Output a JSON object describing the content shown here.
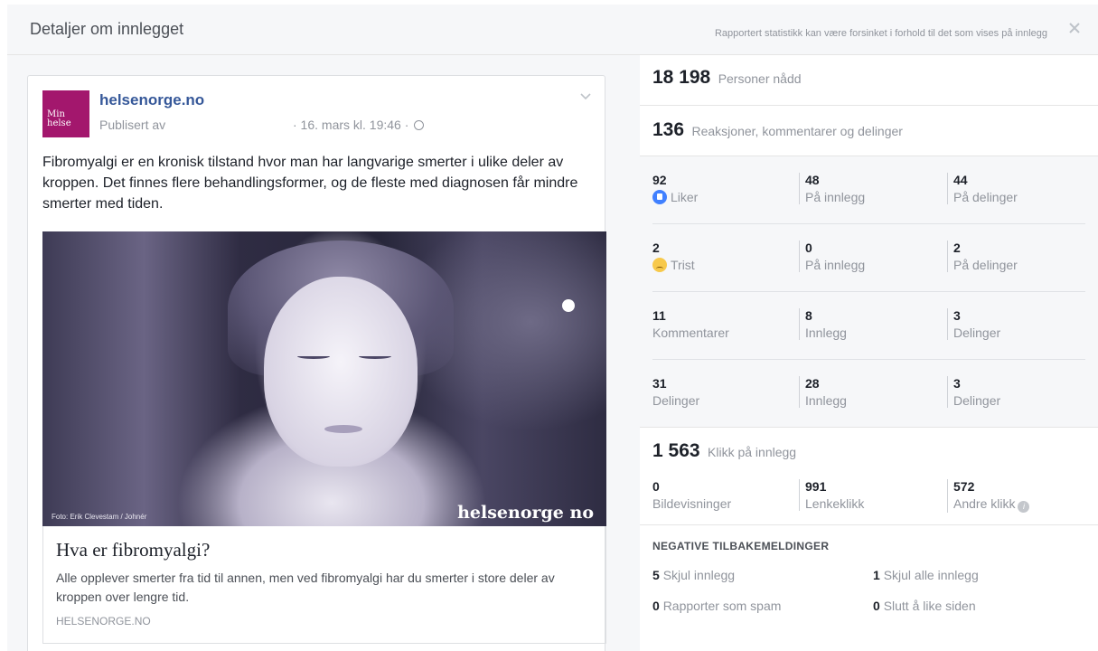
{
  "header": {
    "title": "Detaljer om innlegget",
    "note": "Rapportert statistikk kan være forsinket i forhold til det som vises på innlegg",
    "close_icon": "close-icon"
  },
  "post": {
    "avatar_text_line1": "Min",
    "avatar_text_line2": "helse",
    "page_name": "helsenorge.no",
    "published_by": "Publisert av",
    "date": "· 16. mars kl. 19:46 ·",
    "text": "Fibromyalgi er en kronisk tilstand hvor man har langvarige smerter i ulike deler av kroppen. Det finnes flere behandlingsformer, og de fleste med diagnosen får mindre smerter med tiden.",
    "image": {
      "credit": "Foto: Erik Clevestam / Johnér",
      "logo": "helsenorge no"
    },
    "link": {
      "title": "Hva er fibromyalgi?",
      "description": "Alle opplever smerter fra tid til annen, men ved fibromyalgi har du smerter i store deler av kroppen over lengre tid.",
      "domain": "HELSENORGE.NO"
    }
  },
  "stats": {
    "reach": {
      "value": "18 198",
      "label": "Personer nådd"
    },
    "engagement": {
      "value": "136",
      "label": "Reaksjoner, kommentarer og delinger"
    },
    "rows": [
      {
        "total": "92",
        "total_label": "Liker",
        "icon": "like-icon",
        "a": "48",
        "a_label": "På innlegg",
        "b": "44",
        "b_label": "På delinger"
      },
      {
        "total": "2",
        "total_label": "Trist",
        "icon": "sad-icon",
        "a": "0",
        "a_label": "På innlegg",
        "b": "2",
        "b_label": "På delinger"
      },
      {
        "total": "11",
        "total_label": "Kommentarer",
        "icon": "",
        "a": "8",
        "a_label": "Innlegg",
        "b": "3",
        "b_label": "Delinger"
      },
      {
        "total": "31",
        "total_label": "Delinger",
        "icon": "",
        "a": "28",
        "a_label": "Innlegg",
        "b": "3",
        "b_label": "Delinger"
      }
    ],
    "clicks": {
      "value": "1 563",
      "label": "Klikk på innlegg",
      "items": [
        {
          "value": "0",
          "label": "Bildevisninger"
        },
        {
          "value": "991",
          "label": "Lenkeklikk"
        },
        {
          "value": "572",
          "label": "Andre klikk"
        }
      ]
    },
    "negative": {
      "heading": "NEGATIVE TILBAKEMELDINGER",
      "items": [
        {
          "value": "5",
          "label": "Skjul innlegg"
        },
        {
          "value": "1",
          "label": "Skjul alle innlegg"
        },
        {
          "value": "0",
          "label": "Rapporter som spam"
        },
        {
          "value": "0",
          "label": "Slutt å like siden"
        }
      ]
    }
  }
}
